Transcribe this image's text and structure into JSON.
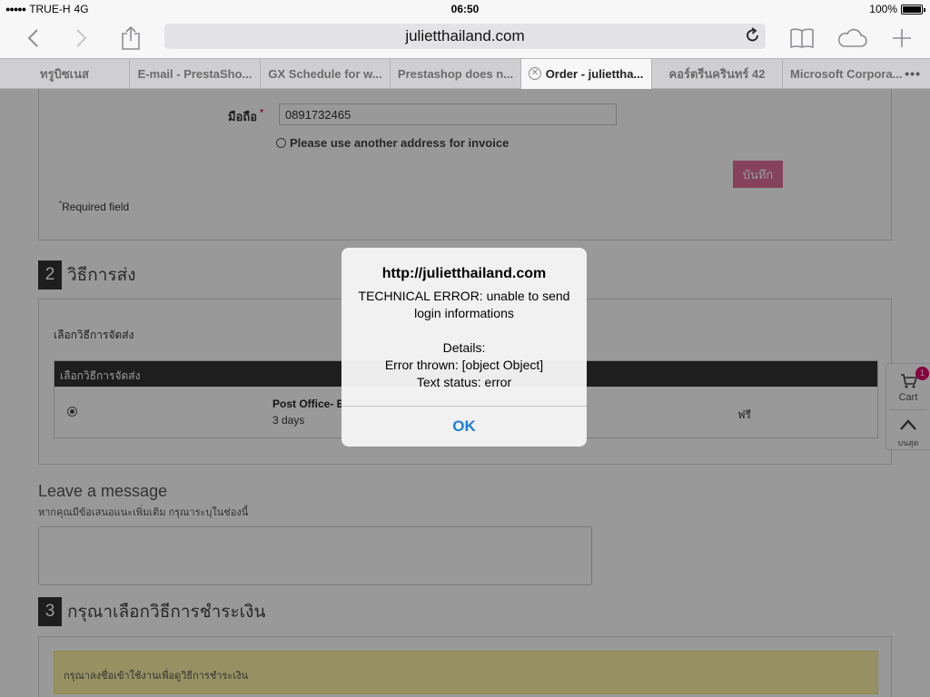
{
  "status_bar": {
    "carrier": "TRUE-H",
    "network": "4G",
    "time": "06:50",
    "battery": "100%"
  },
  "browser": {
    "url": "julietthailand.com",
    "icons": {
      "back": "chevron-left-icon",
      "forward": "chevron-right-icon",
      "share": "share-icon",
      "reload": "reload-icon",
      "bookmarks": "book-icon",
      "cloud": "cloud-icon",
      "new_tab": "plus-icon"
    }
  },
  "tabs": [
    {
      "label": "ทรูบิซเนส",
      "active": false
    },
    {
      "label": "E-mail - PrestaSho...",
      "active": false
    },
    {
      "label": "GX Schedule for w...",
      "active": false
    },
    {
      "label": "Prestashop does n...",
      "active": false
    },
    {
      "label": "Order - juliettha...",
      "active": true
    },
    {
      "label": "คอร์ตรีนครินทร์ 42",
      "active": false
    },
    {
      "label": "Microsoft Corpora...",
      "active": false
    }
  ],
  "address_form": {
    "mobile_label": "มือถือ",
    "required_mark": "*",
    "mobile_value": "0891732465",
    "invoice_checkbox_label": "Please use another address for invoice",
    "save_label": "บันทึก",
    "required_note": "Required field"
  },
  "shipping": {
    "step_number": "2",
    "step_title": "วิธีการส่ง",
    "choose_label": "เลือกวิธีการจัดส่ง",
    "table_header": "เลือกวิธีการจัดส่ง",
    "carrier_name": "Post Office- E",
    "carrier_delay": "3 days",
    "carrier_price": "ฟรี"
  },
  "message": {
    "title": "Leave a message",
    "subtitle": "หากคุณมีข้อเสนอแนะเพิ่มเติม กรุณาระบุในช่องนี้",
    "value": ""
  },
  "payment": {
    "step_number": "3",
    "step_title": "กรุณาเลือกวิธีการชำระเงิน",
    "note": "กรุณาลงชื่อเข้าใช้งานเพื่อดูวิธีการชำระเงิน"
  },
  "side_widget": {
    "cart_label": "Cart",
    "cart_count": "1",
    "top_label": "บนสุด"
  },
  "alert": {
    "title": "http://julietthailand.com",
    "lines": [
      "TECHNICAL ERROR: unable to send",
      "login informations",
      "",
      "Details:",
      "Error thrown: [object Object]",
      "Text status: error"
    ],
    "ok_label": "OK"
  }
}
